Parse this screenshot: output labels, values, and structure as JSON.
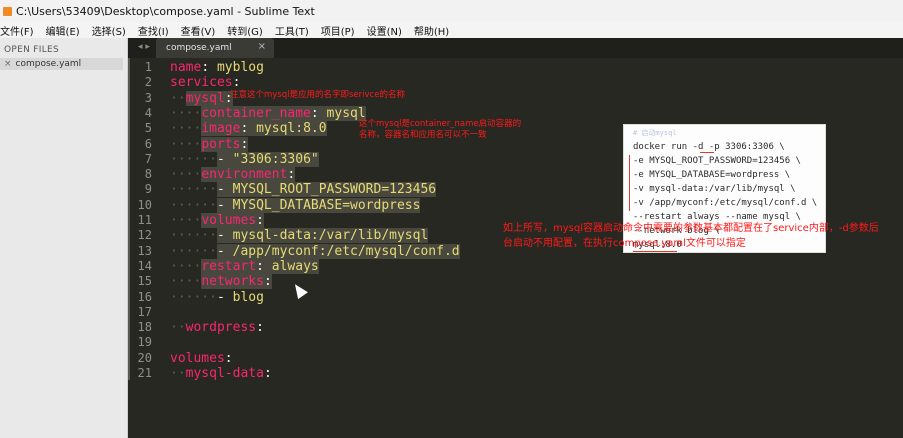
{
  "window": {
    "title": "C:\\Users\\53409\\Desktop\\compose.yaml - Sublime Text"
  },
  "menu": [
    "文件(F)",
    "编辑(E)",
    "选择(S)",
    "查找(I)",
    "查看(V)",
    "转到(G)",
    "工具(T)",
    "项目(P)",
    "设置(N)",
    "帮助(H)"
  ],
  "sidebar": {
    "header": "OPEN FILES",
    "files": [
      {
        "close": "×",
        "name": "compose.yaml"
      }
    ]
  },
  "tabs": {
    "nav": "◂ ▸",
    "items": [
      {
        "label": "compose.yaml",
        "close": "×"
      }
    ]
  },
  "editor": {
    "lines": [
      {
        "n": "1",
        "dots": "",
        "key": "name",
        "sep": ":",
        "val": " myblog"
      },
      {
        "n": "2",
        "dots": "",
        "key": "services",
        "sep": ":",
        "val": ""
      },
      {
        "n": "3",
        "dots": "  ",
        "key": "mysql",
        "sep": ":",
        "val": ""
      },
      {
        "n": "4",
        "dots": "    ",
        "key": "container_name",
        "sep": ":",
        "val": " mysql"
      },
      {
        "n": "5",
        "dots": "    ",
        "key": "image",
        "sep": ":",
        "val": " mysql:8.0"
      },
      {
        "n": "6",
        "dots": "    ",
        "key": "ports",
        "sep": ":",
        "val": ""
      },
      {
        "n": "7",
        "dots": "      ",
        "key": "",
        "sep": "- ",
        "val": "\"3306:3306\""
      },
      {
        "n": "8",
        "dots": "    ",
        "key": "environment",
        "sep": ":",
        "val": ""
      },
      {
        "n": "9",
        "dots": "      ",
        "key": "",
        "sep": "- ",
        "val": "MYSQL_ROOT_PASSWORD=123456"
      },
      {
        "n": "10",
        "dots": "      ",
        "key": "",
        "sep": "- ",
        "val": "MYSQL_DATABASE=wordpress"
      },
      {
        "n": "11",
        "dots": "    ",
        "key": "volumes",
        "sep": ":",
        "val": ""
      },
      {
        "n": "12",
        "dots": "      ",
        "key": "",
        "sep": "- ",
        "val": "mysql-data:/var/lib/mysql"
      },
      {
        "n": "13",
        "dots": "      ",
        "key": "",
        "sep": "- ",
        "val": "/app/myconf:/etc/mysql/conf.d"
      },
      {
        "n": "14",
        "dots": "    ",
        "key": "restart",
        "sep": ":",
        "val": " always"
      },
      {
        "n": "15",
        "dots": "    ",
        "key": "networks",
        "sep": ":",
        "val": ""
      },
      {
        "n": "16",
        "dots": "      ",
        "key": "",
        "sep": "- ",
        "val": "blog"
      },
      {
        "n": "17",
        "dots": "",
        "key": "",
        "sep": "",
        "val": ""
      },
      {
        "n": "18",
        "dots": "  ",
        "key": "wordpress",
        "sep": ":",
        "val": ""
      },
      {
        "n": "19",
        "dots": "",
        "key": "",
        "sep": "",
        "val": ""
      },
      {
        "n": "20",
        "dots": "",
        "key": "volumes",
        "sep": ":",
        "val": ""
      },
      {
        "n": "21",
        "dots": "  ",
        "key": "mysql-data",
        "sep": ":",
        "val": ""
      }
    ]
  },
  "annotations": {
    "service_name": "注意这个mysql是应用的名字即serivce的名称",
    "container_name": "这个mysql是container_name启动容器的\n名称，容器名和应用名可以不一致",
    "summary": "如上所写，mysql容器启动命令中需要的参数基本都配置在了service内部，-d参数后台启动不用配置，在执行compose.yaml文件可以指定"
  },
  "reference_image": {
    "lines": [
      "# 启动mysql",
      "docker run -d -p 3306:3306 \\",
      "-e MYSQL_ROOT_PASSWORD=123456 \\",
      "-e MYSQL_DATABASE=wordpress \\",
      "-v mysql-data:/var/lib/mysql \\",
      "-v /app/myconf:/etc/mysql/conf.d \\",
      "--restart always --name mysql \\",
      "--network blog \\",
      "mysql:8.0"
    ]
  },
  "colors": {
    "key": "#f92672",
    "string": "#e6db74",
    "annotation": "#ff1a1a",
    "background": "#272822"
  }
}
